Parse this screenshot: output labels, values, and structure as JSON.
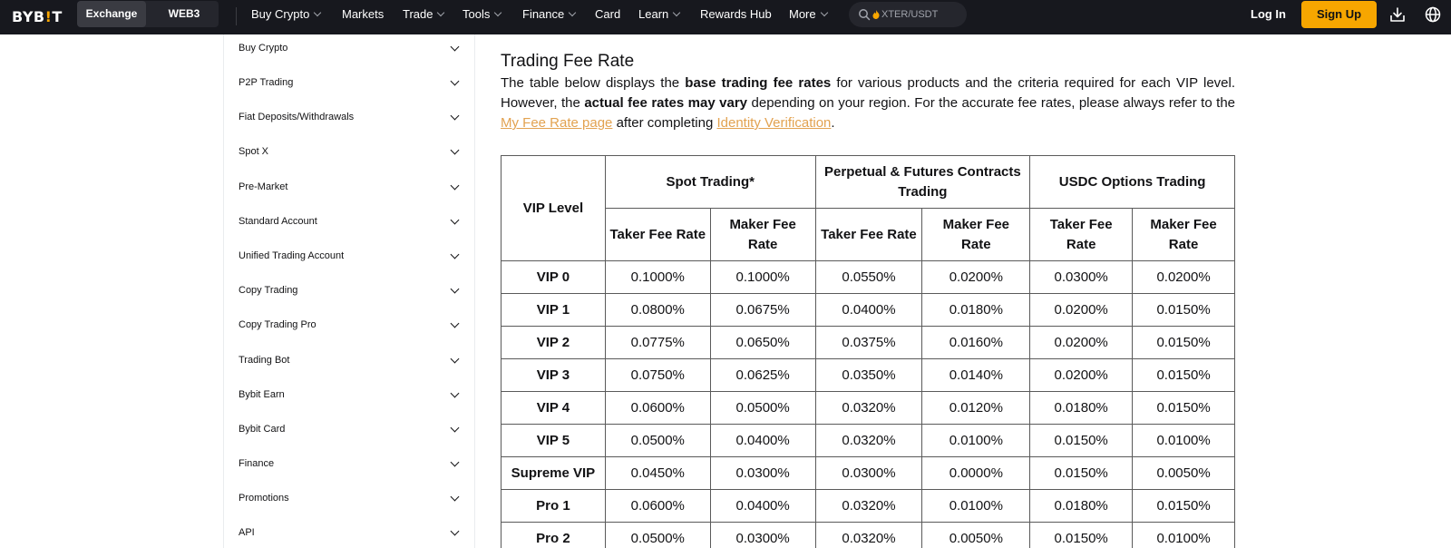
{
  "header": {
    "logo": {
      "text_main": "BYB",
      "text_bang": "!",
      "text_end": "T"
    },
    "env_tabs": [
      "Exchange",
      "WEB3"
    ],
    "nav": [
      {
        "label": "Buy Crypto",
        "has_menu": true
      },
      {
        "label": "Markets",
        "has_menu": false
      },
      {
        "label": "Trade",
        "has_menu": true
      },
      {
        "label": "Tools",
        "has_menu": true
      },
      {
        "label": "Finance",
        "has_menu": true
      },
      {
        "label": "Card",
        "has_menu": false
      },
      {
        "label": "Learn",
        "has_menu": true
      },
      {
        "label": "Rewards Hub",
        "has_menu": false
      },
      {
        "label": "More",
        "has_menu": true
      }
    ],
    "search": {
      "placeholder": "XTER/USDT",
      "icon": "search-icon"
    },
    "login_label": "Log In",
    "signup_label": "Sign Up",
    "icons": [
      "download-icon",
      "globe-icon"
    ],
    "colors": {
      "bar_bg": "#17181e",
      "accent": "#f7a600"
    }
  },
  "sidebar": {
    "items": [
      "Buy Crypto",
      "P2P Trading",
      "Fiat Deposits/Withdrawals",
      "Spot X",
      "Pre-Market",
      "Standard Account",
      "Unified Trading Account",
      "Copy Trading",
      "Copy Trading Pro",
      "Trading Bot",
      "Bybit Earn",
      "Bybit Card",
      "Finance",
      "Promotions",
      "API"
    ]
  },
  "content": {
    "title": "Trading Fee Rate",
    "para": {
      "t1": "The table below displays the ",
      "b1": "base trading fee rates",
      "t2": " for various products and the criteria required for each VIP level. However, the ",
      "b2": "actual fee rates may vary",
      "t3": " depending on your region. For the accurate fee rates, please always refer to the ",
      "link1": "My Fee Rate page",
      "t4": " after completing ",
      "link2": "Identity Verification",
      "t5": "."
    },
    "link_color": "#e2a250",
    "table": {
      "col_vip": "VIP Level",
      "groups": [
        "Spot Trading*",
        "Perpetual & Futures Contracts Trading",
        "USDC Options Trading"
      ],
      "subheaders": [
        "Taker Fee Rate",
        "Maker Fee Rate",
        "Taker Fee Rate",
        "Maker Fee Rate",
        "Taker Fee Rate",
        "Maker Fee Rate"
      ],
      "rows": [
        [
          "VIP 0",
          "0.1000%",
          "0.1000%",
          "0.0550%",
          "0.0200%",
          "0.0300%",
          "0.0200%"
        ],
        [
          "VIP 1",
          "0.0800%",
          "0.0675%",
          "0.0400%",
          "0.0180%",
          "0.0200%",
          "0.0150%"
        ],
        [
          "VIP 2",
          "0.0775%",
          "0.0650%",
          "0.0375%",
          "0.0160%",
          "0.0200%",
          "0.0150%"
        ],
        [
          "VIP 3",
          "0.0750%",
          "0.0625%",
          "0.0350%",
          "0.0140%",
          "0.0200%",
          "0.0150%"
        ],
        [
          "VIP 4",
          "0.0600%",
          "0.0500%",
          "0.0320%",
          "0.0120%",
          "0.0180%",
          "0.0150%"
        ],
        [
          "VIP 5",
          "0.0500%",
          "0.0400%",
          "0.0320%",
          "0.0100%",
          "0.0150%",
          "0.0100%"
        ],
        [
          "Supreme VIP",
          "0.0450%",
          "0.0300%",
          "0.0300%",
          "0.0000%",
          "0.0150%",
          "0.0050%"
        ],
        [
          "Pro 1",
          "0.0600%",
          "0.0400%",
          "0.0320%",
          "0.0100%",
          "0.0180%",
          "0.0150%"
        ],
        [
          "Pro 2",
          "0.0500%",
          "0.0300%",
          "0.0320%",
          "0.0050%",
          "0.0150%",
          "0.0100%"
        ]
      ]
    }
  }
}
